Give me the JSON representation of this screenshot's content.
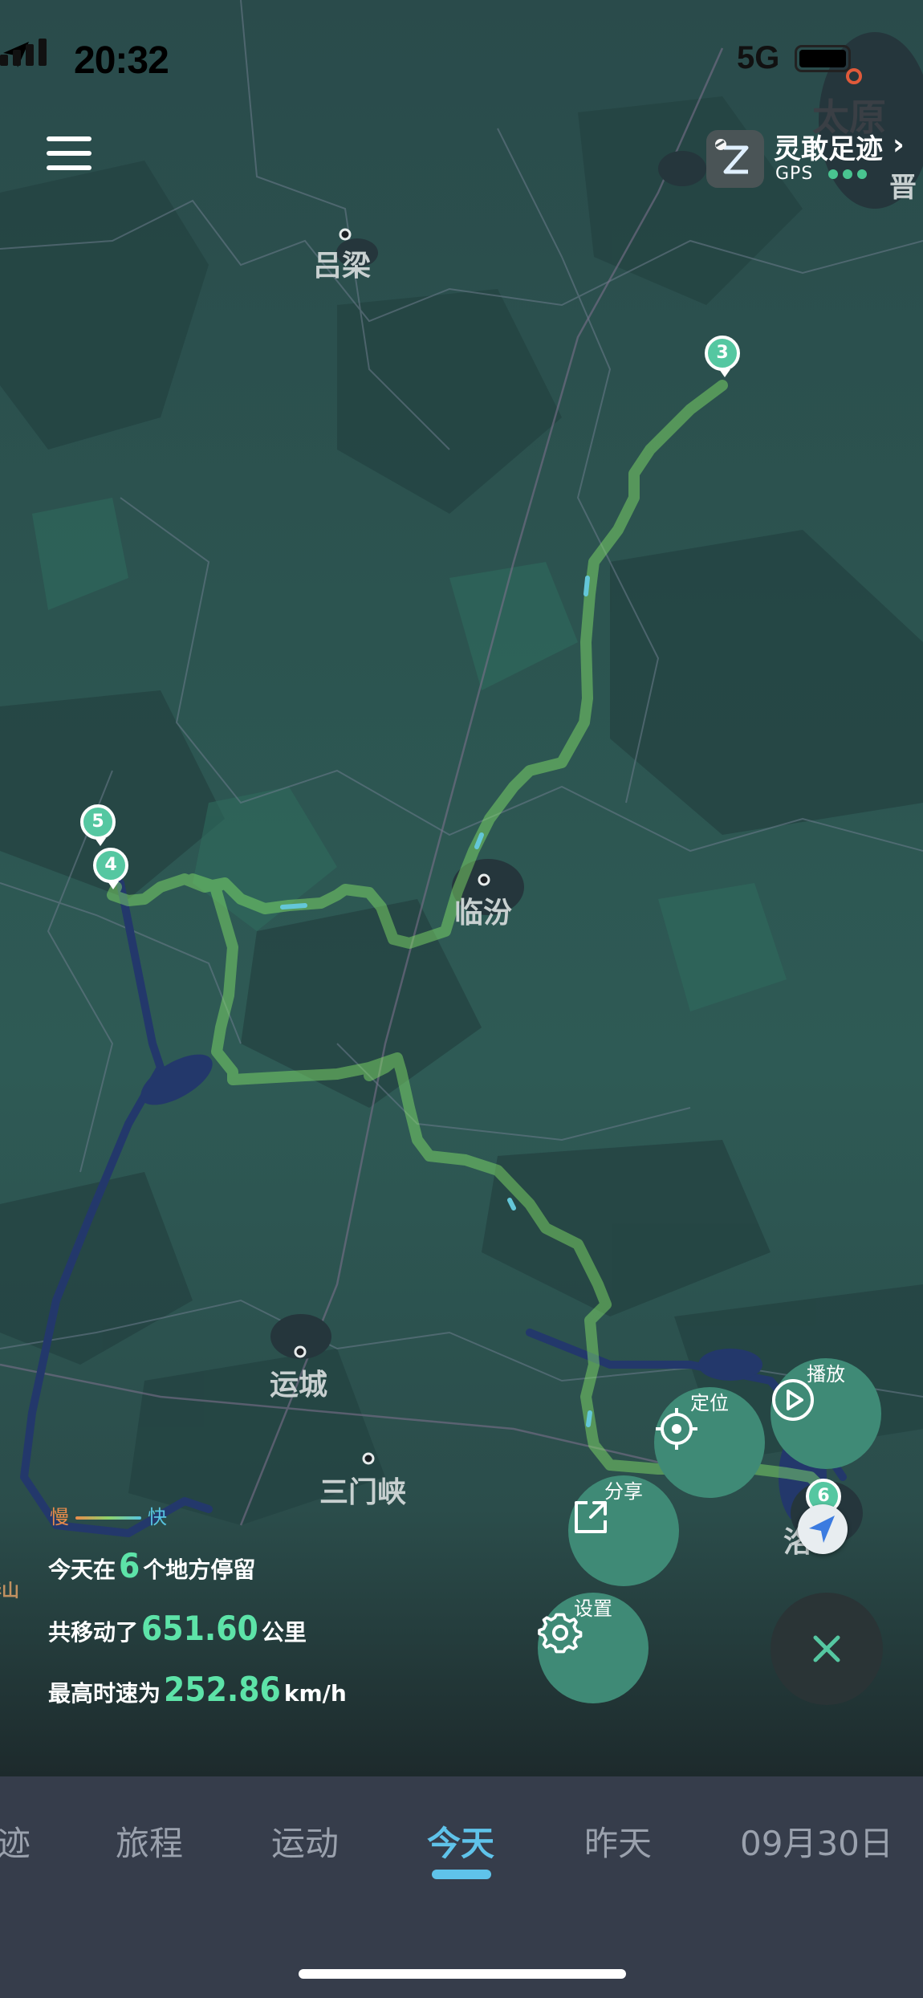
{
  "status_bar": {
    "time": "20:32",
    "network": "5G"
  },
  "brand": {
    "name": "灵敢足迹",
    "gps_label": "GPS",
    "chevron": "›"
  },
  "map": {
    "cities": {
      "taiyuan": "太原",
      "jin": "晋",
      "lvliang": "吕梁",
      "linfen": "临汾",
      "yuncheng": "运城",
      "sanmenxia": "三门峡",
      "luo": "洛",
      "shan": "华山"
    },
    "markers": {
      "m3": "3",
      "m4": "4",
      "m5": "5",
      "m6": "6"
    },
    "route_color": "#8df06a",
    "water_color": "#23386b"
  },
  "legend": {
    "slow": "慢",
    "fast": "快"
  },
  "stats": {
    "stops_prefix": "今天在",
    "stops_value": "6",
    "stops_suffix": "个地方停留",
    "distance_prefix": "共移动了",
    "distance_value": "651.60",
    "distance_suffix": "公里",
    "speed_prefix": "最高时速为",
    "speed_value": "252.86",
    "speed_suffix": "km/h"
  },
  "actions": {
    "locate": "定位",
    "play": "播放",
    "share": "分享",
    "settings": "设置"
  },
  "icons": [
    "location-arrow-icon",
    "signal-icon",
    "battery-icon",
    "menu-icon",
    "app-logo-icon",
    "crosshair-icon",
    "play-icon",
    "share-icon",
    "gear-icon",
    "close-icon",
    "navigation-arrow-icon"
  ],
  "tabs": [
    {
      "label": "迹"
    },
    {
      "label": "旅程"
    },
    {
      "label": "运动"
    },
    {
      "label": "今天"
    },
    {
      "label": "昨天"
    },
    {
      "label": "09月30日"
    }
  ],
  "active_tab": "今天"
}
